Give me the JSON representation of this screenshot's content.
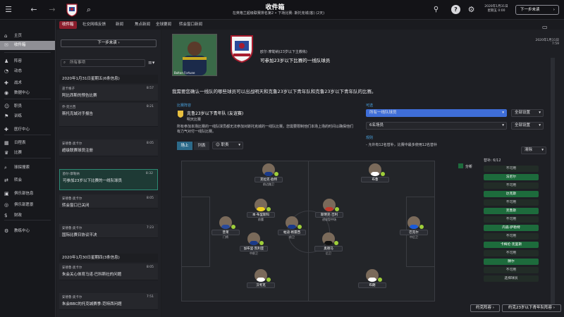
{
  "topbar": {
    "title": "收件箱",
    "subtitle": "在英格兰超级联赛排名第2 • 下场比赛: 斯托克城(客) (2天)",
    "date_line1": "2020年1月31日",
    "date_line2": "星期五 0:00",
    "continue_label": "下一步未读"
  },
  "tabs": [
    "收件箱",
    "社交网络反馈",
    "新闻",
    "焦点新闻",
    "全球要闻",
    "转会窗口新闻"
  ],
  "nav": [
    {
      "icon": "home-icon",
      "glyph": "⌂",
      "label": "主页"
    },
    {
      "icon": "inbox-icon",
      "glyph": "✉",
      "label": "收件箱"
    },
    {
      "icon": "squad-icon",
      "glyph": "♟",
      "label": "阵容"
    },
    {
      "icon": "dynamics-icon",
      "glyph": "◔",
      "label": "动态"
    },
    {
      "icon": "tactics-icon",
      "glyph": "✚",
      "label": "战术"
    },
    {
      "icon": "data-hub-icon",
      "glyph": "◉",
      "label": "数据中心"
    },
    {
      "icon": "staff-icon",
      "glyph": "☺",
      "label": "职员"
    },
    {
      "icon": "training-icon",
      "glyph": "⚑",
      "label": "训练"
    },
    {
      "icon": "medical-icon",
      "glyph": "✚",
      "label": "医疗中心"
    },
    {
      "icon": "schedule-icon",
      "glyph": "▦",
      "label": "日程表"
    },
    {
      "icon": "competitions-icon",
      "glyph": "♛",
      "label": "比赛"
    },
    {
      "icon": "scouting-icon",
      "glyph": "⌕",
      "label": "球探搜索"
    },
    {
      "icon": "transfers-icon",
      "glyph": "⇄",
      "label": "转会"
    },
    {
      "icon": "club-info-icon",
      "glyph": "▣",
      "label": "俱乐部信息"
    },
    {
      "icon": "club-vision-icon",
      "glyph": "◎",
      "label": "俱乐部愿景"
    },
    {
      "icon": "finance-icon",
      "glyph": "$",
      "label": "财政"
    },
    {
      "icon": "career-icon",
      "glyph": "⚙",
      "label": "教练中心"
    }
  ],
  "inbox": {
    "next_unread": "下一步未读",
    "search_placeholder": "所有事项",
    "date_header_1": "2020年1月31日星期五(6条信息)",
    "date_header_2": "2020年1月30日星期四(3条信息)",
    "messages": [
      {
        "sender": "巫卡根子",
        "time": "8:57",
        "subject": "阿比西斯的预告比赛"
      },
      {
        "sender": "乔·克兰西",
        "time": "8:21",
        "subject": "斯托克城对手报告"
      },
      {
        "sender": "安德鲁·奥卡尔",
        "time": "8:05",
        "subject": "超级联赛球员注册"
      },
      {
        "sender": "欧尔·摩勒纳",
        "time": "8:32",
        "subject": "可参加23岁以下比赛的一线队球员"
      },
      {
        "sender": "安德鲁·奥卡尔",
        "time": "8:05",
        "subject": "转会窗口已关闭"
      },
      {
        "sender": "安德鲁·奥卡尔",
        "time": "7:23",
        "subject": "国际比赛日协议平决"
      },
      {
        "sender": "安德鲁·奥卡尔",
        "time": "8:05",
        "subject": "朱会关心体育马诺·巴科斯社的问题"
      },
      {
        "sender": "安德鲁·奥卡尔",
        "time": "7:51",
        "subject": "朱会BBC的托克城赛季:范特西问题"
      }
    ]
  },
  "message": {
    "sender_line": "欧尔·摩勒纳(23岁以下主教练)",
    "subject": "可参加23岁以下比赛的一线队球员",
    "date": "2020年1月31日 7:59",
    "photo_caption": "Bolton Fortune",
    "body": "我需要您确认一线队的哪些球员可以出战明天和克鲁23岁以下青年队和克鲁23岁以下青年队的比赛。",
    "fixture_section": "比赛阵容",
    "fixture_title": "克鲁23岁以下青年队 (友谊赛)",
    "fixture_when": "明天比赛",
    "fixture_note": "所有参加本场比赛的一线队球员都无法参加对斯托克城的一线队比赛。您需要限制他们本场上场的时间以确保他们有力气对付一线队比赛。",
    "view_tab_1": "场上",
    "view_tab_2": "列表",
    "view_dropdown": "职责",
    "options_label": "可选",
    "opt_primary": "所有一线队球员",
    "opt_primary_side": "全部设置",
    "opt_secondary": "6名场员",
    "opt_secondary_side": "全部设置",
    "rules_label": "规则",
    "rules_text": "- 允许有12名替补，比赛中最多使用12名替补",
    "analysis_label": "分析",
    "clear_label": "清除",
    "subs_label": "替补: 6/12"
  },
  "players": [
    {
      "name": "克拉克·伯特",
      "role": "前边路卫",
      "shirt": "#1a3a8a"
    },
    {
      "name": "布鲁",
      "role": "",
      "shirt": "#ffffff"
    },
    {
      "name": "本·布里斯科",
      "role": "前腰",
      "shirt": "#f0d020"
    },
    {
      "name": "斯明克·吉利",
      "role": "进攻型中场",
      "shirt": "#c0392b"
    },
    {
      "name": "普莱",
      "role": "门将",
      "shirt": "#2a4a9a"
    },
    {
      "name": "帕迪·格雷西",
      "role": "前卫",
      "shirt": "#1a3a8a"
    },
    {
      "name": "加布里·凯利亚",
      "role": "中前卫",
      "shirt": "#1a3a8a"
    },
    {
      "name": "奥德马",
      "role": "后卫",
      "shirt": "#111111"
    },
    {
      "name": "巴克尔",
      "role": "中后卫",
      "shirt": "#1a5ad8"
    },
    {
      "name": "汉考克",
      "role": "",
      "shirt": "#ffffff"
    },
    {
      "name": "布朗",
      "role": "",
      "shirt": "#ffffff"
    }
  ],
  "subs": [
    {
      "label": "不可用",
      "type": "g"
    },
    {
      "label": "法尼尔",
      "type": "h"
    },
    {
      "label": "不可用",
      "type": "g"
    },
    {
      "label": "达克斯",
      "type": "h"
    },
    {
      "label": "不可用",
      "type": "g"
    },
    {
      "label": "克鲁斯",
      "type": "h"
    },
    {
      "label": "不可用",
      "type": "g"
    },
    {
      "label": "内森·萨勒特",
      "type": "h"
    },
    {
      "label": "不可用",
      "type": "g"
    },
    {
      "label": "卡梅伦·克里斯",
      "type": "h"
    },
    {
      "label": "不可用",
      "type": "g"
    },
    {
      "label": "滕尔",
      "type": "h"
    },
    {
      "label": "不可用",
      "type": "g"
    },
    {
      "label": "选择球员",
      "type": "g"
    }
  ],
  "footer": {
    "btn_1": "约克阵容",
    "btn_2": "约克23岁以下青年队阵容"
  },
  "colors": {
    "accent": "#8b1d2c",
    "highlight": "#2c8a74",
    "available": "#9fcf3a"
  }
}
